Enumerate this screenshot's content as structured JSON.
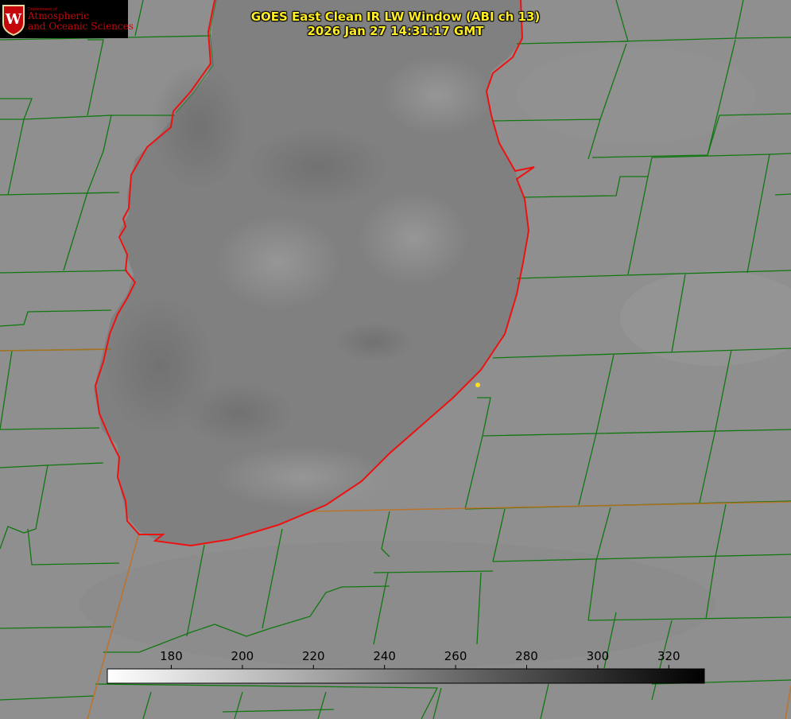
{
  "title": {
    "line1": "GOES East Clean IR LW Window (ABI ch 13)",
    "line2": "2026 Jan 27 14:31:17 GMT"
  },
  "logo": {
    "dept": "Department of",
    "line1": "Atmospheric",
    "line2": "and Oceanic Sciences",
    "seal_letter": "W"
  },
  "colorbar": {
    "ticks": [
      "180",
      "200",
      "220",
      "240",
      "260",
      "280",
      "300",
      "320"
    ],
    "range": [
      162,
      330
    ],
    "colors": {
      "low": "#ffffff",
      "high": "#000000"
    }
  },
  "colors": {
    "lake_shore": "#ee1111",
    "county_lines": "#117711",
    "title_text": "#ffee22",
    "logo_red": "#c5050c",
    "marker": "#ffdd22"
  },
  "marker": {
    "name": "station-point",
    "icon": "yellow-dot"
  }
}
